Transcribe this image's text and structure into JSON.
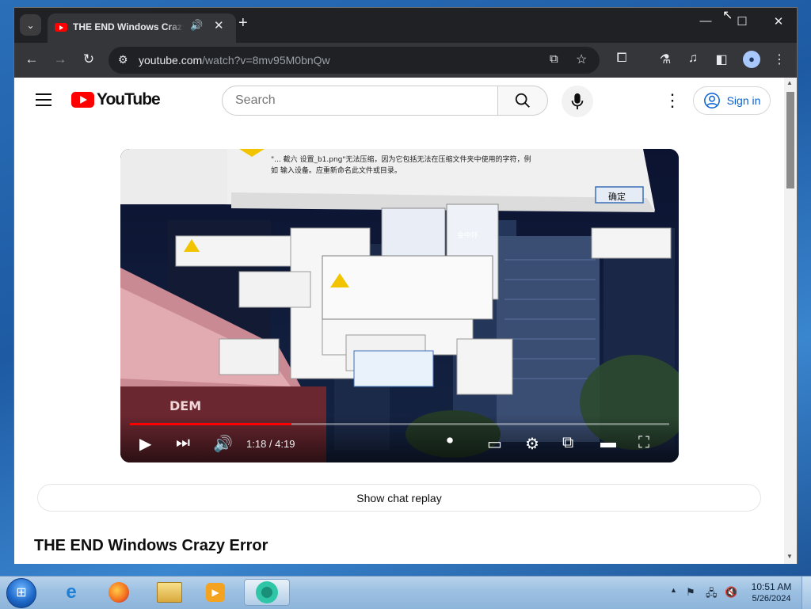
{
  "browser": {
    "tab_title": "THE END Windows Crazy Error - YouTube",
    "url_host": "youtube.com",
    "url_path": "/watch?v=8mv95M0bnQw",
    "new_tab": "+",
    "minimize": "—",
    "maximize": "☐",
    "close": "✕"
  },
  "header": {
    "logo_text": "YouTube",
    "search_placeholder": "Search",
    "sign_in": "Sign in"
  },
  "player": {
    "time": "1:18 / 4:19",
    "progress": 0.3
  },
  "page": {
    "show_chat": "Show chat replay",
    "video_title": "THE END Windows Crazy Error"
  },
  "dialogs": {
    "top_message_line1": "\"... 截六 设置_b1.png\"无法压缩，因为它包括无法在压缩文件夹中使用的字符，例",
    "top_message_line2": "如 输入设备。应重新命名此文件或目录。",
    "ok_button": "确定",
    "building_sign": "金中环",
    "street_sign": "DEM"
  },
  "taskbar": {
    "time": "10:51 AM",
    "date": "5/26/2024"
  },
  "colors": {
    "youtube_red": "#ff0000",
    "signin_blue": "#065fd4",
    "chrome_dark": "#202124",
    "chrome_toolbar": "#35363a"
  }
}
